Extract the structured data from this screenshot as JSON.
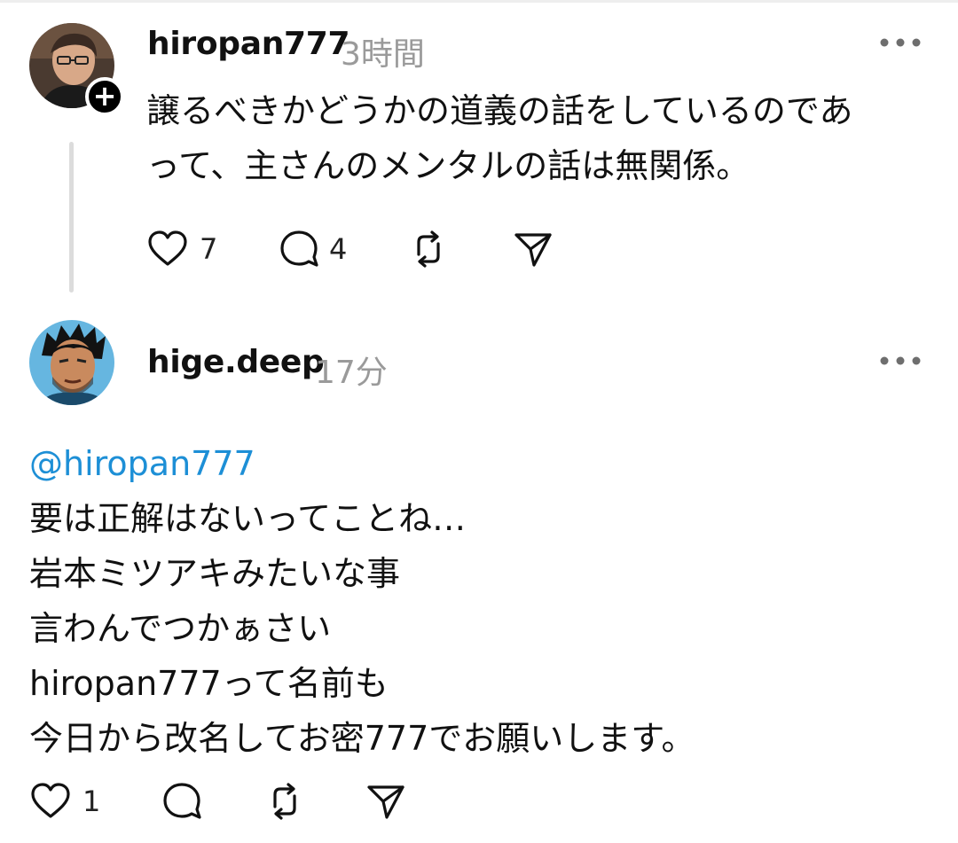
{
  "posts": [
    {
      "username": "hiropan777",
      "time": "3時間",
      "lines": [
        "譲るべきかどうかの道義の話をしているのであ",
        "って、主さんのメンタルの話は無関係。"
      ],
      "likes": "7",
      "replies": "4",
      "icons": [
        "heart-icon",
        "comment-icon",
        "repost-icon",
        "share-icon",
        "more-icon",
        "plus-icon"
      ]
    },
    {
      "username": "hige.deep",
      "time": "17分",
      "mention": "@hiropan777",
      "lines": [
        "要は正解はないってことね…",
        "岩本ミツアキみたいな事",
        "言わんでつかぁさい",
        "hiropan777って名前も",
        "今日から改名してお密777でお願いします。"
      ],
      "likes": "1",
      "icons": [
        "heart-icon",
        "comment-icon",
        "repost-icon",
        "share-icon",
        "more-icon"
      ]
    }
  ],
  "colors": {
    "text": "#111111",
    "muted": "#9a9a9a",
    "mention": "#1d8fd6",
    "thread_line": "#dcdcdc"
  }
}
